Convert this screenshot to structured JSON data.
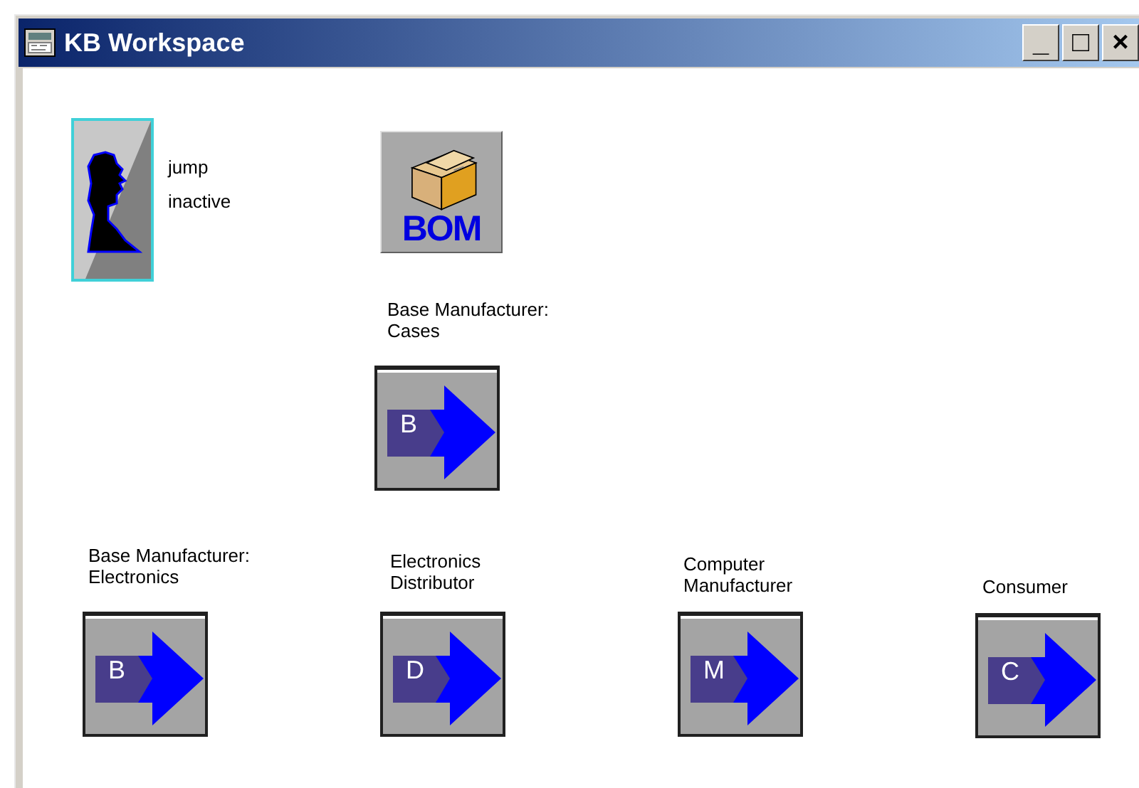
{
  "window": {
    "title": "KB Workspace",
    "controls": [
      "_",
      "□",
      "×"
    ]
  },
  "person": {
    "labels": [
      "jump",
      "inactive"
    ]
  },
  "bom": {
    "label": "BOM"
  },
  "agents": [
    {
      "label": [
        "Base Manufacturer:",
        "Cases"
      ],
      "letter": "B"
    },
    {
      "label": [
        "Base Manufacturer:",
        "Electronics"
      ],
      "letter": "B"
    },
    {
      "label": [
        "Electronics",
        "Distributor"
      ],
      "letter": "D"
    },
    {
      "label": [
        "Computer",
        "Manufacturer"
      ],
      "letter": "M"
    },
    {
      "label": [
        "Consumer"
      ],
      "letter": "C"
    }
  ]
}
